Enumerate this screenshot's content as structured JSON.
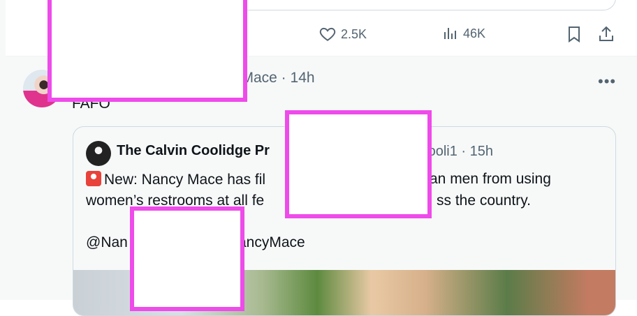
{
  "actions": {
    "likes": "2.5K",
    "views": "46K"
  },
  "post": {
    "handle_time": "yMace · 14h",
    "text": "FAFO",
    "quote": {
      "name": "The Calvin Coolidge Pr",
      "handle_time": "nCooli1 · 15h",
      "line1": "New: Nancy Mace has fil",
      "line1_end": "an men from using",
      "line2": "women’s restrooms at all fe",
      "line2_end": "ss the country.",
      "line3": "@Nan",
      "line3_end": "ancyMace"
    }
  },
  "colors": {
    "redaction_border": "#ee4bea",
    "muted_text": "#536471"
  },
  "icons": [
    "heart-icon",
    "views-icon",
    "bookmark-icon",
    "share-icon",
    "more-icon",
    "siren-icon"
  ]
}
